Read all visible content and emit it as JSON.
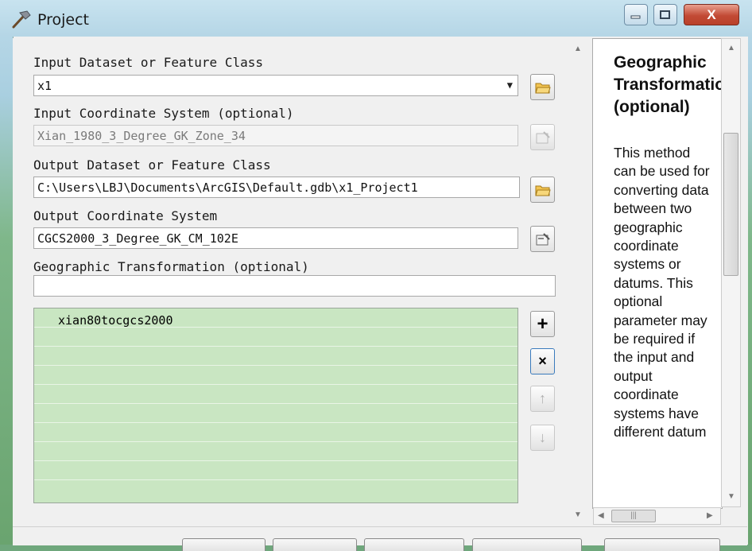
{
  "window": {
    "title": "Project",
    "close_glyph": "X",
    "icon": "hammer-icon"
  },
  "form": {
    "input_dataset": {
      "label": "Input Dataset or Feature Class",
      "value": "x1"
    },
    "input_cs": {
      "label": "Input Coordinate System (optional)",
      "value": "Xian_1980_3_Degree_GK_Zone_34"
    },
    "output_dataset": {
      "label": "Output Dataset or Feature Class",
      "value": "C:\\Users\\LBJ\\Documents\\ArcGIS\\Default.gdb\\x1_Project1"
    },
    "output_cs": {
      "label": "Output Coordinate System",
      "value": "CGCS2000_3_Degree_GK_CM_102E"
    },
    "geo_transform": {
      "label": "Geographic Transformation (optional)",
      "value": "",
      "items": [
        "xian80tocgcs2000"
      ]
    }
  },
  "help": {
    "title": "Geographic Transformation (optional)",
    "body": "This method can be used for converting data between two geographic coordinate systems or datums. This optional parameter may be required if the input and output coordinate systems have different datum"
  },
  "colors": {
    "list_bg": "#c9e6c2",
    "close_button": "#c24a35"
  }
}
